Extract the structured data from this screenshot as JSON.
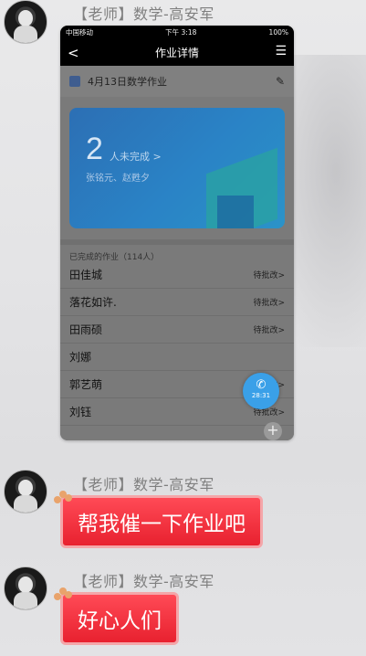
{
  "messages": [
    {
      "sender": "【老师】数学-高安军"
    },
    {
      "sender": "【老师】数学-高安军",
      "text": "帮我催一下作业吧"
    },
    {
      "sender": "【老师】数学-高安军",
      "text": "好心人们"
    }
  ],
  "screenshot": {
    "status_carrier": "中国移动",
    "status_time": "下午 3:18",
    "status_battery": "100%",
    "nav_back": "<",
    "nav_title": "作业详情",
    "nav_menu": "☰",
    "homework_title": "4月13日数学作业",
    "not_done_count": "2",
    "not_done_label": "人未完成 >",
    "not_done_names": "张铭元、赵甦夕",
    "completed_header": "已完成的作业（114人）",
    "rows": [
      {
        "name": "田佳城",
        "status": "待批改>"
      },
      {
        "name": "落花如许.",
        "status": "待批改>"
      },
      {
        "name": "田雨硕",
        "status": "待批改>"
      },
      {
        "name": "刘娜",
        "status": ""
      },
      {
        "name": "郭艺萌",
        "status": "待批改>"
      },
      {
        "name": "刘钰",
        "status": "待批改>"
      }
    ],
    "call_timer": "28:31"
  },
  "colors": {
    "bubble": "#e8212f",
    "card": "#2a83c6",
    "call": "#3aa0e8"
  }
}
